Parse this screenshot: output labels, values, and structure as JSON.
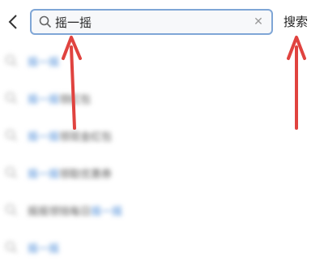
{
  "header": {
    "back_icon": "chevron-left-icon",
    "search": {
      "value": "摇一摇",
      "icon": "search-icon",
      "clear_icon": "clear-icon"
    },
    "search_button_label": "搜索"
  },
  "suggestions": [
    {
      "highlight": "摇一摇",
      "rest": ""
    },
    {
      "highlight": "摇一摇",
      "rest": "领红包"
    },
    {
      "highlight": "摇一摇",
      "rest": "领现金红包"
    },
    {
      "highlight": "摇一摇",
      "rest": "领取优惠券"
    },
    {
      "prefix": "摇摇领钱每日",
      "highlight": "摇一摇",
      "rest": ""
    },
    {
      "highlight": "摇一摇",
      "rest": ""
    }
  ],
  "colors": {
    "accent": "#4a8bd8",
    "annotation_arrow": "#e0433f",
    "search_border": "#7fa6d6"
  }
}
